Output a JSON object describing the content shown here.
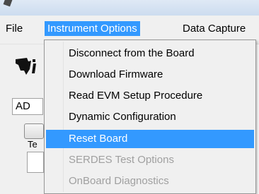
{
  "menubar": {
    "items": [
      {
        "label": "File"
      },
      {
        "label": "Instrument Options"
      },
      {
        "label": "Data Capture"
      }
    ]
  },
  "app": {
    "combo_value": "AD",
    "label_partial": "Te"
  },
  "dropdown": {
    "items": [
      {
        "label": "Disconnect from the Board",
        "state": "normal"
      },
      {
        "label": "Download Firmware",
        "state": "normal"
      },
      {
        "label": "Read EVM Setup Procedure",
        "state": "normal"
      },
      {
        "label": "Dynamic Configuration",
        "state": "normal"
      },
      {
        "label": "Reset Board",
        "state": "highlighted"
      },
      {
        "label": "SERDES Test Options",
        "state": "disabled"
      },
      {
        "label": "OnBoard Diagnostics",
        "state": "disabled"
      }
    ]
  },
  "colors": {
    "highlight": "#3399ff",
    "menu_bg": "#f0f0f0",
    "disabled_text": "#a0a0a0"
  },
  "icons": {
    "logo": "texas-instruments-logo-icon"
  }
}
